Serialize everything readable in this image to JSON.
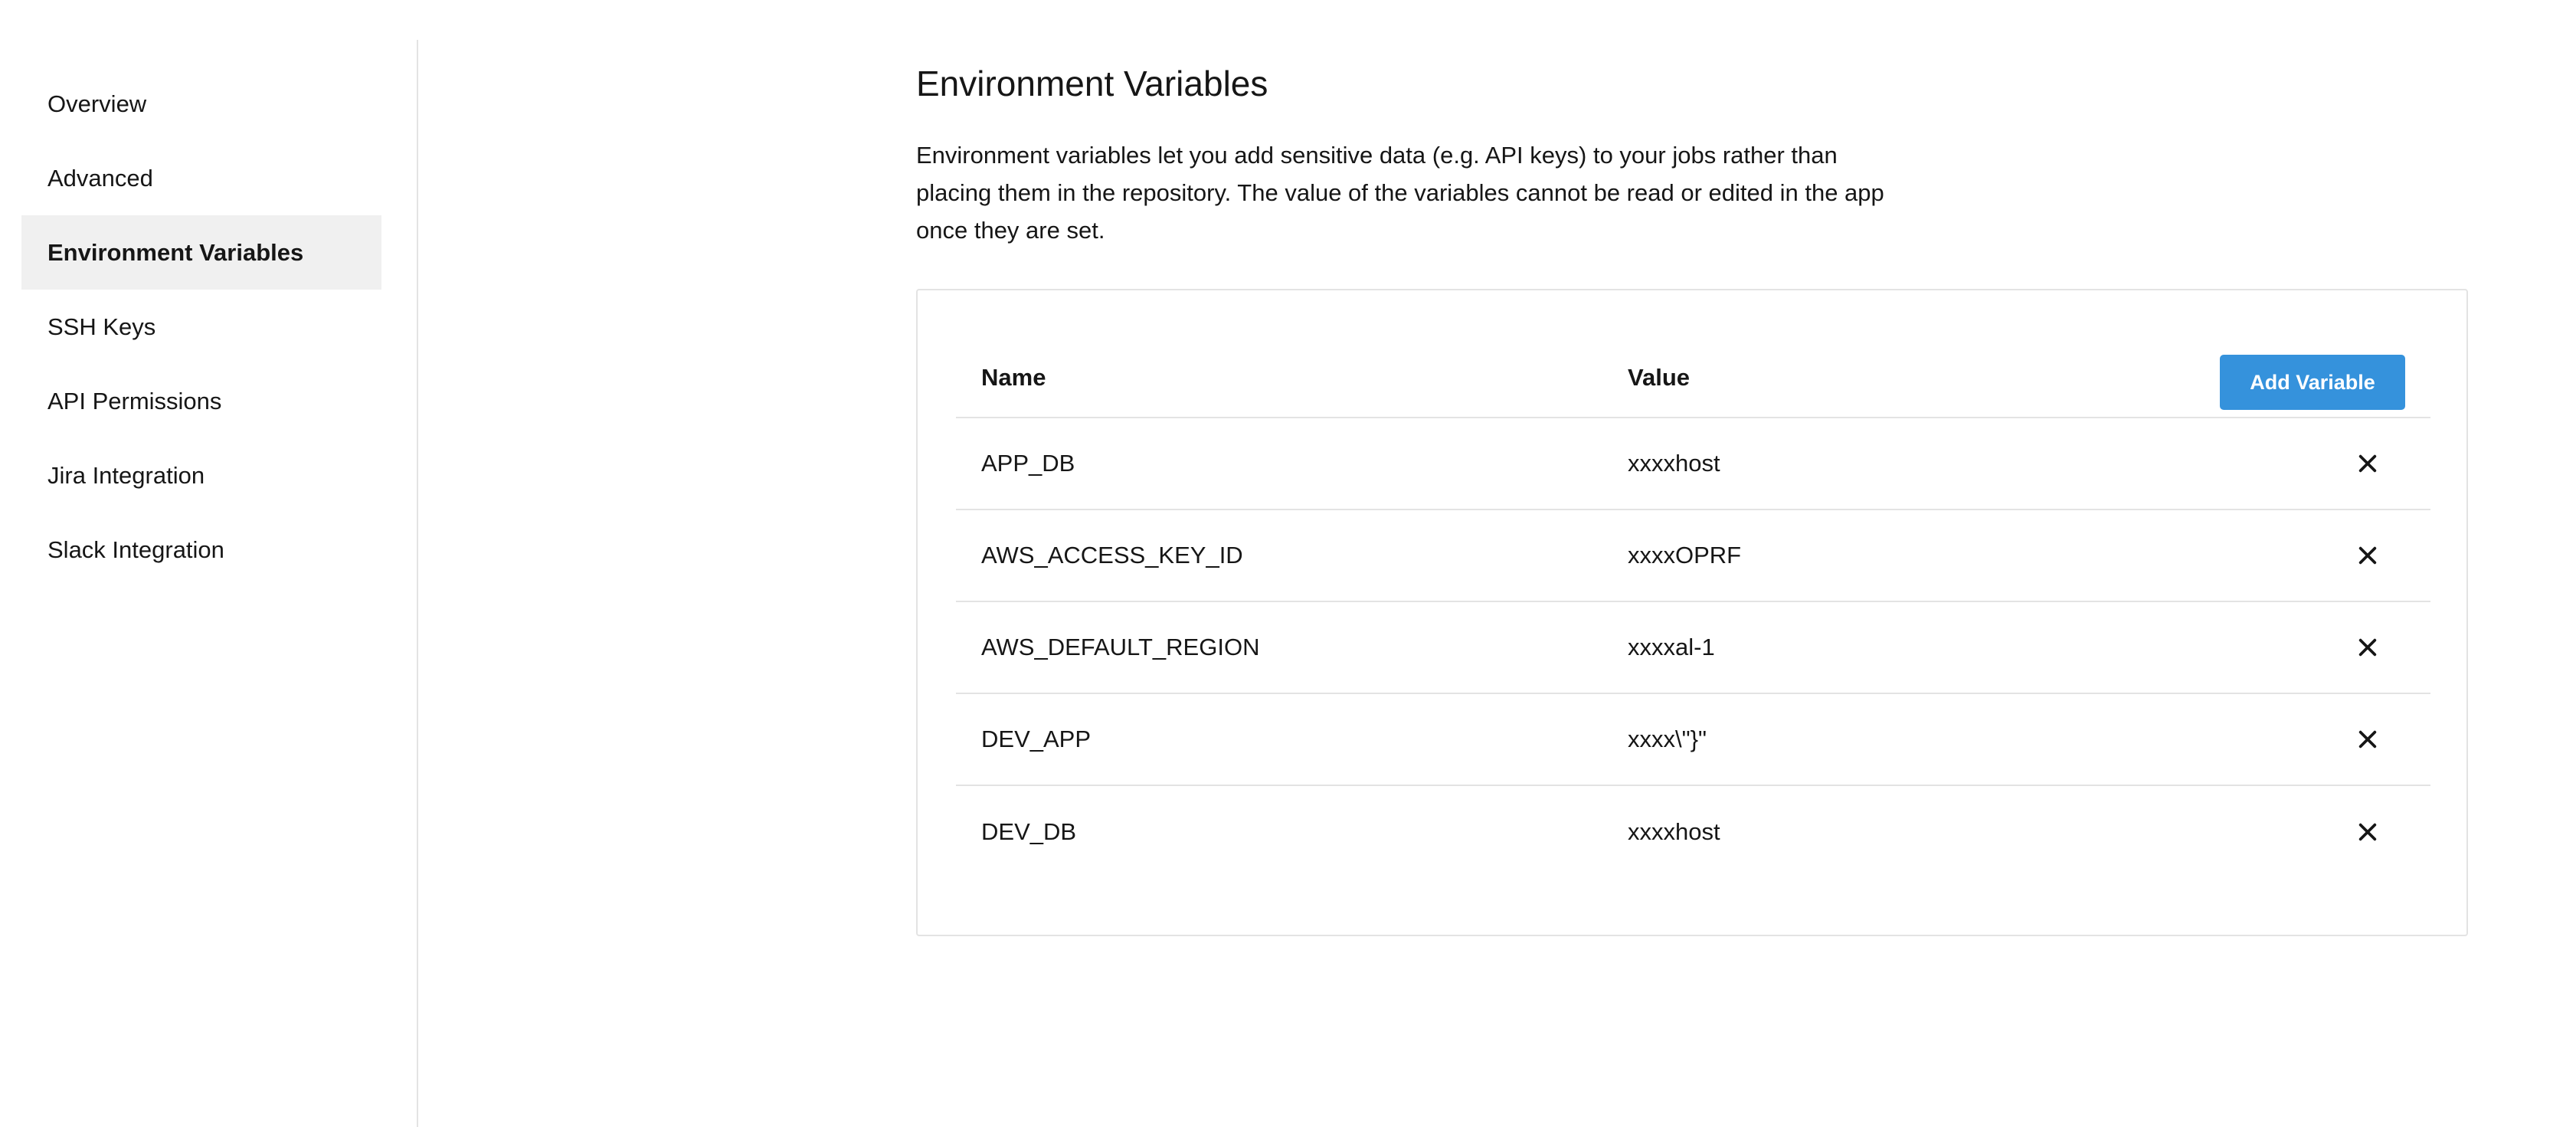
{
  "sidebar": {
    "items": [
      {
        "label": "Overview",
        "active": false
      },
      {
        "label": "Advanced",
        "active": false
      },
      {
        "label": "Environment Variables",
        "active": true
      },
      {
        "label": "SSH Keys",
        "active": false
      },
      {
        "label": "API Permissions",
        "active": false
      },
      {
        "label": "Jira Integration",
        "active": false
      },
      {
        "label": "Slack Integration",
        "active": false
      }
    ]
  },
  "main": {
    "title": "Environment Variables",
    "description": "Environment variables let you add sensitive data (e.g. API keys) to your jobs rather than placing them in the repository. The value of the variables cannot be read or edited in the app once they are set."
  },
  "table": {
    "columns": {
      "name": "Name",
      "value": "Value"
    },
    "add_button_label": "Add Variable",
    "delete_icon": "close-icon",
    "rows": [
      {
        "name": "APP_DB",
        "value": "xxxxhost"
      },
      {
        "name": "AWS_ACCESS_KEY_ID",
        "value": "xxxxOPRF"
      },
      {
        "name": "AWS_DEFAULT_REGION",
        "value": "xxxxal-1"
      },
      {
        "name": "DEV_APP",
        "value": "xxxx\\\"}\""
      },
      {
        "name": "DEV_DB",
        "value": "xxxxhost"
      }
    ]
  },
  "colors": {
    "accent": "#3592dc",
    "active_bg": "#f0f0f0",
    "border": "#e3e3e3"
  }
}
